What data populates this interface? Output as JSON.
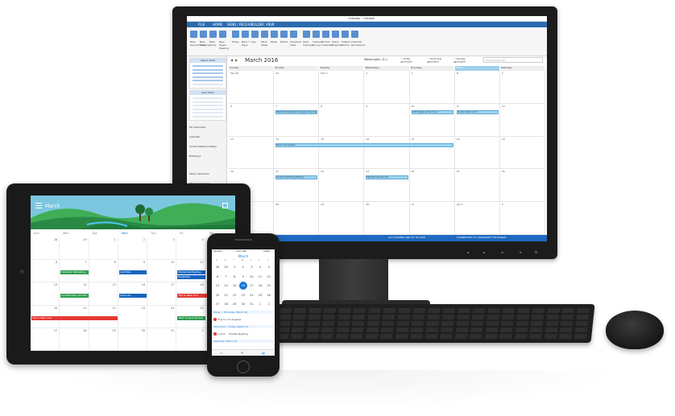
{
  "desktop": {
    "window_title": "Calendar - Outlook",
    "menu": [
      "FILE",
      "HOME",
      "SEND / RECEIVE",
      "FOLDER",
      "VIEW"
    ],
    "ribbon": [
      "New Appointment",
      "New Meeting",
      "New Items",
      "New Skype Meeting",
      "Today",
      "Next 7 Days",
      "Day",
      "Work Week",
      "Week",
      "Month",
      "Schedule View",
      "Open Calendar",
      "Calendar Groups",
      "E-mail Calendar",
      "Share Calendar",
      "Publish Online",
      "Calendar Permissions"
    ],
    "mini_calendars": [
      {
        "title": "March 2016"
      },
      {
        "title": "April 2016"
      }
    ],
    "folders": [
      "My Calendars",
      "Calendar",
      "United States holidays",
      "Birthdays",
      "Other Calendars",
      "Shared Calendars"
    ],
    "month_title": "March 2016",
    "location": "Washington, D.C.",
    "weather": [
      {
        "label": "Today",
        "temp": "49°F/35°F"
      },
      {
        "label": "Tomorrow",
        "temp": "48°F/35°F"
      },
      {
        "label": "Sunday",
        "temp": "48°F/35°F"
      }
    ],
    "search_placeholder": "Search Calendar",
    "day_headers": [
      "Sunday",
      "Monday",
      "Tuesday",
      "Wednesday",
      "Thursday",
      "Friday",
      "Saturday"
    ],
    "weeks": [
      [
        "Feb 28",
        "29",
        "Mar 1",
        "2",
        "3",
        "4",
        "5"
      ],
      [
        "6",
        "7",
        "8",
        "9",
        "10",
        "11",
        "12"
      ],
      [
        "13",
        "14",
        "15",
        "16",
        "17",
        "18",
        "19"
      ],
      [
        "20",
        "21",
        "22",
        "23",
        "24",
        "25",
        "26"
      ],
      [
        "27",
        "28",
        "29",
        "30",
        "31",
        "Apr 1",
        "2"
      ]
    ],
    "events": [
      {
        "week": 1,
        "day": 1,
        "span": 1,
        "text": "Fabrikam Marketing Campaign Planning Meeting"
      },
      {
        "week": 1,
        "day": 4,
        "span": 1,
        "text": "4:30 Tailspin product sync"
      },
      {
        "week": 1,
        "day": 5,
        "span": 1,
        "text": "Contoso team lunch"
      },
      {
        "week": 2,
        "day": 1,
        "span": 4,
        "text": "Trip to Los Angeles"
      },
      {
        "week": 3,
        "day": 1,
        "span": 1,
        "text": "Contoso Marketing Meeting"
      },
      {
        "week": 3,
        "day": 3,
        "span": 1,
        "text": "Fabrikam Review Call"
      }
    ],
    "status_left": "ALL FOLDERS ARE UP TO DATE",
    "status_right": "CONNECTED TO: MICROSOFT EXCHANGE"
  },
  "tablet": {
    "title": "March",
    "day_headers": [
      "Sun",
      "Mon",
      "Tue",
      "Wed",
      "Thu",
      "Fri",
      "Sat"
    ],
    "weeks": [
      [
        "28",
        "29",
        "1",
        "2",
        "3",
        "4",
        "5"
      ],
      [
        "6",
        "7",
        "8",
        "9",
        "10",
        "11",
        "12"
      ],
      [
        "13",
        "14",
        "15",
        "16",
        "17",
        "18",
        "19"
      ],
      [
        "20",
        "21",
        "22",
        "23",
        "24",
        "25",
        "26"
      ],
      [
        "27",
        "28",
        "29",
        "30",
        "31",
        "1",
        "2"
      ]
    ],
    "events": [
      {
        "week": 2,
        "day": 1,
        "span": 1,
        "color": "green",
        "text": "Fabrikam Marketing"
      },
      {
        "week": 2,
        "day": 3,
        "span": 1,
        "color": "blue",
        "text": "Call Mike"
      },
      {
        "week": 2,
        "day": 5,
        "span": 1,
        "color": "blue",
        "text": "Marketing Meeting"
      },
      {
        "week": 2,
        "day": 5,
        "span": 1,
        "color": "blue",
        "text": "Breakfast"
      },
      {
        "week": 3,
        "day": 1,
        "span": 1,
        "color": "green",
        "text": "Confidential call with"
      },
      {
        "week": 3,
        "day": 3,
        "span": 1,
        "color": "blue",
        "text": "Call Luke"
      },
      {
        "week": 3,
        "day": 5,
        "span": 2,
        "color": "red",
        "text": "Trip to New York"
      },
      {
        "week": 4,
        "day": 0,
        "span": 3,
        "color": "red",
        "text": "Trip to New York"
      },
      {
        "week": 4,
        "day": 5,
        "span": 1,
        "color": "green",
        "text": "Team Project Review"
      }
    ]
  },
  "phone": {
    "carrier": "Verizon",
    "time": "9:37 AM",
    "battery": "100%",
    "month": "March",
    "weekdays": [
      "S",
      "M",
      "T",
      "W",
      "T",
      "F",
      "S"
    ],
    "weeks": [
      [
        "28",
        "29",
        "1",
        "2",
        "3",
        "4",
        "5"
      ],
      [
        "6",
        "7",
        "8",
        "9",
        "10",
        "11",
        "12"
      ],
      [
        "13",
        "14",
        "15",
        "16",
        "17",
        "18",
        "19"
      ],
      [
        "20",
        "21",
        "22",
        "23",
        "24",
        "25",
        "26"
      ],
      [
        "27",
        "28",
        "29",
        "30",
        "31",
        "1",
        "2"
      ]
    ],
    "selected": "16",
    "agenda": [
      {
        "head": true,
        "text": "Today • Thursday, March 10"
      },
      {
        "head": false,
        "text": "Trip to Los Angeles",
        "dot": true
      },
      {
        "head": true,
        "text": "Tomorrow • Friday, March 11"
      },
      {
        "head": false,
        "text": "Lunch",
        "dot": true,
        "extra": "Update Meeting"
      },
      {
        "head": true,
        "text": "Saturday, March 12"
      }
    ],
    "tabs": [
      "Calendar",
      "Mail",
      "Files"
    ]
  },
  "colors": {
    "outlook_blue": "#1e6ac0",
    "event_blue": "#9dd4f0",
    "tablet_green": "#2e9d4f",
    "tablet_red": "#e53935"
  }
}
